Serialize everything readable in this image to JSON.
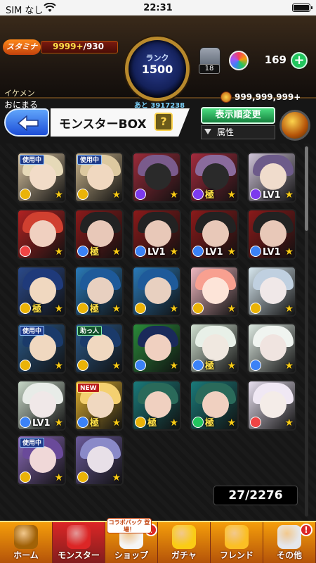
{
  "status_bar": {
    "carrier": "SIM なし",
    "time": "22:31"
  },
  "header": {
    "stamina_label": "スタミナ",
    "stamina_current": "9999+",
    "stamina_max": "/930",
    "rank_label": "ランク",
    "rank_value": "1500",
    "rank_next": "あと 3917238",
    "name_label": "イケメン",
    "name_value": "おにまる",
    "gauge_value": "18",
    "orb_count": "169",
    "coins": "999,999,999+"
  },
  "titlebar": {
    "title": "モンスターBOX",
    "help_label": "?",
    "sort_label": "表示順変更",
    "filter_label": "属性"
  },
  "colors": {
    "fire": "#ef4444",
    "water": "#3b82f6",
    "wood": "#22c55e",
    "light": "#eab308",
    "dark": "#7c3aed"
  },
  "monsters": [
    {
      "tag": "使用中",
      "tag_type": "inuse",
      "element": "light",
      "label": "",
      "bg": "#d8c3a0",
      "hair": "#e6d9b8",
      "face": "#f2dcc8"
    },
    {
      "tag": "使用中",
      "tag_type": "inuse",
      "element": "light",
      "label": "",
      "bg": "#c9b48c",
      "hair": "#ddc9a0",
      "face": "#f0d8c0"
    },
    {
      "tag": "",
      "tag_type": "",
      "element": "dark",
      "label": "",
      "bg": "#9b2b3a",
      "hair": "#7a5b8c",
      "face": "#2a2a2a"
    },
    {
      "tag": "",
      "tag_type": "",
      "element": "dark",
      "label": "極",
      "bg": "#a32b3d",
      "hair": "#8a6b9c",
      "face": "#2a2a2a"
    },
    {
      "tag": "",
      "tag_type": "",
      "element": "dark",
      "label": "LV1",
      "bg": "#cfc4d8",
      "hair": "#6d5b8a",
      "face": "#f0dccc"
    },
    {
      "tag": "",
      "tag_type": "",
      "element": "fire",
      "label": "",
      "bg": "#b22222",
      "hair": "#d04030",
      "face": "#f0d0c0"
    },
    {
      "tag": "",
      "tag_type": "",
      "element": "water",
      "label": "極",
      "bg": "#8b1a1a",
      "hair": "#222",
      "face": "#e8c8b8"
    },
    {
      "tag": "",
      "tag_type": "",
      "element": "water",
      "label": "LV1",
      "bg": "#8b1a1a",
      "hair": "#222",
      "face": "#e8c8b8"
    },
    {
      "tag": "",
      "tag_type": "",
      "element": "water",
      "label": "LV1",
      "bg": "#8b1a1a",
      "hair": "#222",
      "face": "#e8c8b8"
    },
    {
      "tag": "",
      "tag_type": "",
      "element": "water",
      "label": "LV1",
      "bg": "#8b1a1a",
      "hair": "#222",
      "face": "#e8c8b8"
    },
    {
      "tag": "",
      "tag_type": "",
      "element": "light",
      "label": "極",
      "bg": "#2b4a8a",
      "hair": "#1f3a7a",
      "face": "#f0d8c0"
    },
    {
      "tag": "",
      "tag_type": "",
      "element": "light",
      "label": "極",
      "bg": "#2a7ab8",
      "hair": "#1e5a9a",
      "face": "#e8d0c0"
    },
    {
      "tag": "",
      "tag_type": "",
      "element": "light",
      "label": "",
      "bg": "#2a7ab8",
      "hair": "#1e5a9a",
      "face": "#e8d0c0"
    },
    {
      "tag": "",
      "tag_type": "",
      "element": "light",
      "label": "",
      "bg": "#f0b8c0",
      "hair": "#f8a090",
      "face": "#fde4d8"
    },
    {
      "tag": "",
      "tag_type": "",
      "element": "light",
      "label": "",
      "bg": "#d8e8f0",
      "hair": "#c0d0e0",
      "face": "#f0e8e8"
    },
    {
      "tag": "使用中",
      "tag_type": "inuse",
      "element": "light",
      "label": "",
      "bg": "#2b5a8a",
      "hair": "#1a3a6a",
      "face": "#f0d8c0"
    },
    {
      "tag": "助っ人",
      "tag_type": "fav",
      "element": "light",
      "label": "",
      "bg": "#2b5a8a",
      "hair": "#1a3a6a",
      "face": "#f0d8c0"
    },
    {
      "tag": "",
      "tag_type": "",
      "element": "water",
      "label": "",
      "bg": "#2a8a3a",
      "hair": "#1a2a5a",
      "face": "#f0d0c0"
    },
    {
      "tag": "",
      "tag_type": "",
      "element": "water",
      "label": "極",
      "bg": "#d0e0d0",
      "hair": "#e8f0e8",
      "face": "#f0e8e0"
    },
    {
      "tag": "",
      "tag_type": "",
      "element": "water",
      "label": "",
      "bg": "#dce8e0",
      "hair": "#f0f4f0",
      "face": "#f0e4e0"
    },
    {
      "tag": "",
      "tag_type": "",
      "element": "water",
      "label": "LV1",
      "bg": "#c8d8c8",
      "hair": "#e8ece8",
      "face": "#f0e8e8"
    },
    {
      "tag": "NEW",
      "tag_type": "new",
      "element": "water",
      "label": "極",
      "bg": "#e0b030",
      "hair": "#f4d070",
      "face": "#f0d8c0"
    },
    {
      "tag": "",
      "tag_type": "",
      "element": "light",
      "label": "極",
      "bg": "#1a7a7a",
      "hair": "#2a6a5a",
      "face": "#f0d0c0"
    },
    {
      "tag": "",
      "tag_type": "",
      "element": "wood",
      "label": "極",
      "bg": "#1a7a7a",
      "hair": "#2a6a5a",
      "face": "#f0d0c0"
    },
    {
      "tag": "",
      "tag_type": "",
      "element": "fire",
      "label": "",
      "bg": "#e8e0f0",
      "hair": "#f0e8f4",
      "face": "#f4ece8"
    },
    {
      "tag": "使用中",
      "tag_type": "inuse",
      "element": "light",
      "label": "",
      "bg": "#8a6ab8",
      "hair": "#6a4a9a",
      "face": "#f0d8d8"
    },
    {
      "tag": "",
      "tag_type": "",
      "element": "light",
      "label": "",
      "bg": "#6a5a9a",
      "hair": "#8a8ac8",
      "face": "#e8e0e8"
    }
  ],
  "box_count": "27/2276",
  "nav": [
    {
      "label": "ホーム",
      "color": "#a16207",
      "notif": ""
    },
    {
      "label": "モンスター",
      "color": "#dc2626",
      "notif": ""
    },
    {
      "label": "ショップ",
      "color": "#f5f5f5",
      "notif": "!"
    },
    {
      "label": "ガチャ",
      "color": "#facc15",
      "notif": ""
    },
    {
      "label": "フレンド",
      "color": "#fbbf24",
      "notif": ""
    },
    {
      "label": "その他",
      "color": "#e5e7eb",
      "notif": "!"
    }
  ],
  "collab_tag": "コラボパック 登場！"
}
